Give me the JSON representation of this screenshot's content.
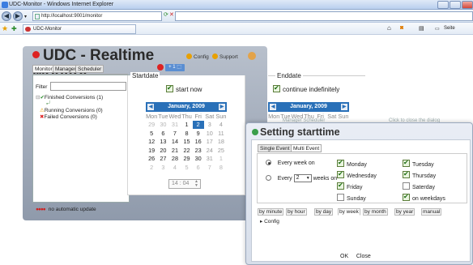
{
  "browser": {
    "window_title": "UDC-Monitor - Windows Internet Explorer",
    "url": "http://localhost:9001/monitor",
    "tab_title": "UDC-Monitor",
    "page_menu": "Seite"
  },
  "app": {
    "title": "UDC - Realtime Monitor",
    "config_link": "Config",
    "support_link": "Support",
    "tabs": [
      "Monitor",
      "Manager",
      "Scheduler"
    ],
    "filter_label": "Filter",
    "tree": [
      "Finished Conversions (1)",
      "Running Conversions (0)",
      "Failed Conversions (0)"
    ],
    "status": "no automatic update"
  },
  "startdate": {
    "legend": "Startdate",
    "start_now": "start now",
    "calendar": {
      "month": "January, 2009",
      "weekdays": [
        "Mon",
        "Tue",
        "Wed",
        "Thu",
        "Fri",
        "Sat",
        "Sun"
      ],
      "weeks": [
        [
          "29",
          "30",
          "31",
          "1",
          "2",
          "3",
          "4"
        ],
        [
          "5",
          "6",
          "7",
          "8",
          "9",
          "10",
          "11"
        ],
        [
          "12",
          "13",
          "14",
          "15",
          "16",
          "17",
          "18"
        ],
        [
          "19",
          "20",
          "21",
          "22",
          "23",
          "24",
          "25"
        ],
        [
          "26",
          "27",
          "28",
          "29",
          "30",
          "31",
          "1"
        ],
        [
          "2",
          "3",
          "4",
          "5",
          "6",
          "7",
          "8"
        ]
      ],
      "selected": "2"
    },
    "time": "14 : 04"
  },
  "enddate": {
    "legend": "Enddate",
    "continue": "continue indefinitely",
    "calendar_month": "January, 2009",
    "weekdays": [
      "Mon",
      "Tue",
      "Wed",
      "Thu",
      "Fri",
      "Sat",
      "Sun"
    ],
    "behind_tab": "Manager Scheduler",
    "behind_hint": "Click to close the dialog"
  },
  "dialog": {
    "title": "Setting starttime",
    "tabs": [
      "Single Event",
      "Multi Event"
    ],
    "every_week_on": "Every week on",
    "every": "Every",
    "weeks_value": "2",
    "weeks_on": "weeks on",
    "days": [
      {
        "label": "Monday",
        "checked": true
      },
      {
        "label": "Tuesday",
        "checked": true
      },
      {
        "label": "Wednesday",
        "checked": true
      },
      {
        "label": "Thursday",
        "checked": true
      },
      {
        "label": "Friday",
        "checked": true
      },
      {
        "label": "Saterday",
        "checked": false
      },
      {
        "label": "Sunday",
        "checked": false
      },
      {
        "label": "on weekdays",
        "checked": true
      }
    ],
    "by_tabs": [
      "by minute",
      "by hour",
      "by day",
      "by week",
      "by month",
      "by year",
      "manual"
    ],
    "selected_by_tab": "by week",
    "config": "Config",
    "ok": "OK",
    "close": "Close"
  }
}
